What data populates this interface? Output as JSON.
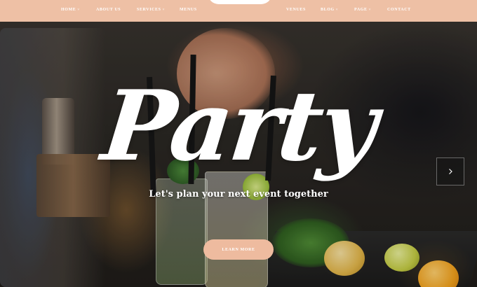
{
  "nav": {
    "items": [
      {
        "label": "HOME",
        "dropdown": true
      },
      {
        "label": "ABOUT US",
        "dropdown": false
      },
      {
        "label": "SERVICES",
        "dropdown": true
      },
      {
        "label": "MENUS",
        "dropdown": false
      },
      {
        "label": "VENUES",
        "dropdown": false
      },
      {
        "label": "BLOG",
        "dropdown": true
      },
      {
        "label": "PAGE",
        "dropdown": true
      },
      {
        "label": "CONTACT",
        "dropdown": false
      }
    ],
    "caret": "˅"
  },
  "hero": {
    "headline": "Party",
    "tagline": "Let's plan your next event together",
    "cta_label": "LEARN MORE",
    "next_icon": "chevron-right-icon"
  },
  "colors": {
    "nav_background": "#eec0a5",
    "button_background": "#eebb9f",
    "text": "#ffffff"
  }
}
